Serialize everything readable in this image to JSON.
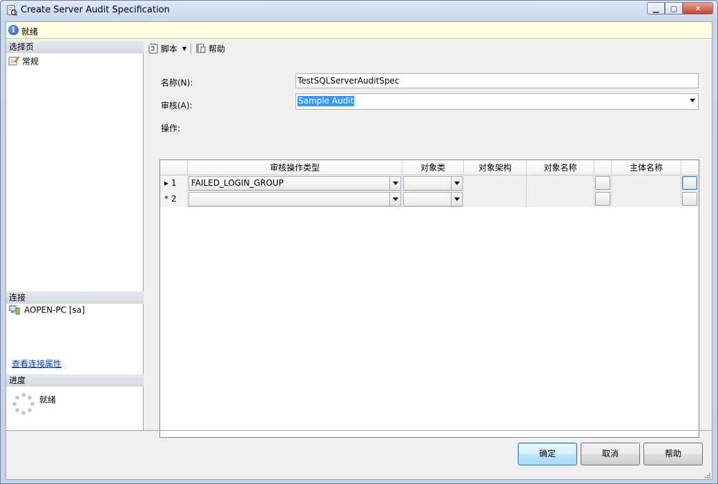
{
  "window": {
    "title": "Create Server Audit Specification"
  },
  "infobar": {
    "status": "就绪"
  },
  "left_panel": {
    "select_page_header": "选择页",
    "pages": [
      {
        "label": "常规"
      }
    ],
    "connection_header": "连接",
    "connection_name": "AOPEN-PC [sa]",
    "view_connection_link": "查看连接属性",
    "progress_header": "进度",
    "progress_status": "就绪"
  },
  "toolbar": {
    "script_label": "脚本",
    "help_label": "帮助"
  },
  "form": {
    "name_label": "名称(N):",
    "name_value": "TestSQLServerAuditSpec",
    "audit_label": "审核(A):",
    "audit_value": "Sample Audit",
    "actions_label": "操作:"
  },
  "grid": {
    "columns": [
      "审核操作类型",
      "对象类",
      "对象架构",
      "对象名称",
      "主体名称"
    ],
    "rows": [
      {
        "marker": "▸",
        "number": "1",
        "action_type": "FAILED_LOGIN_GROUP",
        "object_class": "",
        "object_schema": "",
        "object_name": "",
        "principal": ""
      },
      {
        "marker": "*",
        "number": "2",
        "action_type": "",
        "object_class": "",
        "object_schema": "",
        "object_name": "",
        "principal": ""
      }
    ]
  },
  "buttons": {
    "ok": "确定",
    "cancel": "取消",
    "help": "帮助"
  }
}
